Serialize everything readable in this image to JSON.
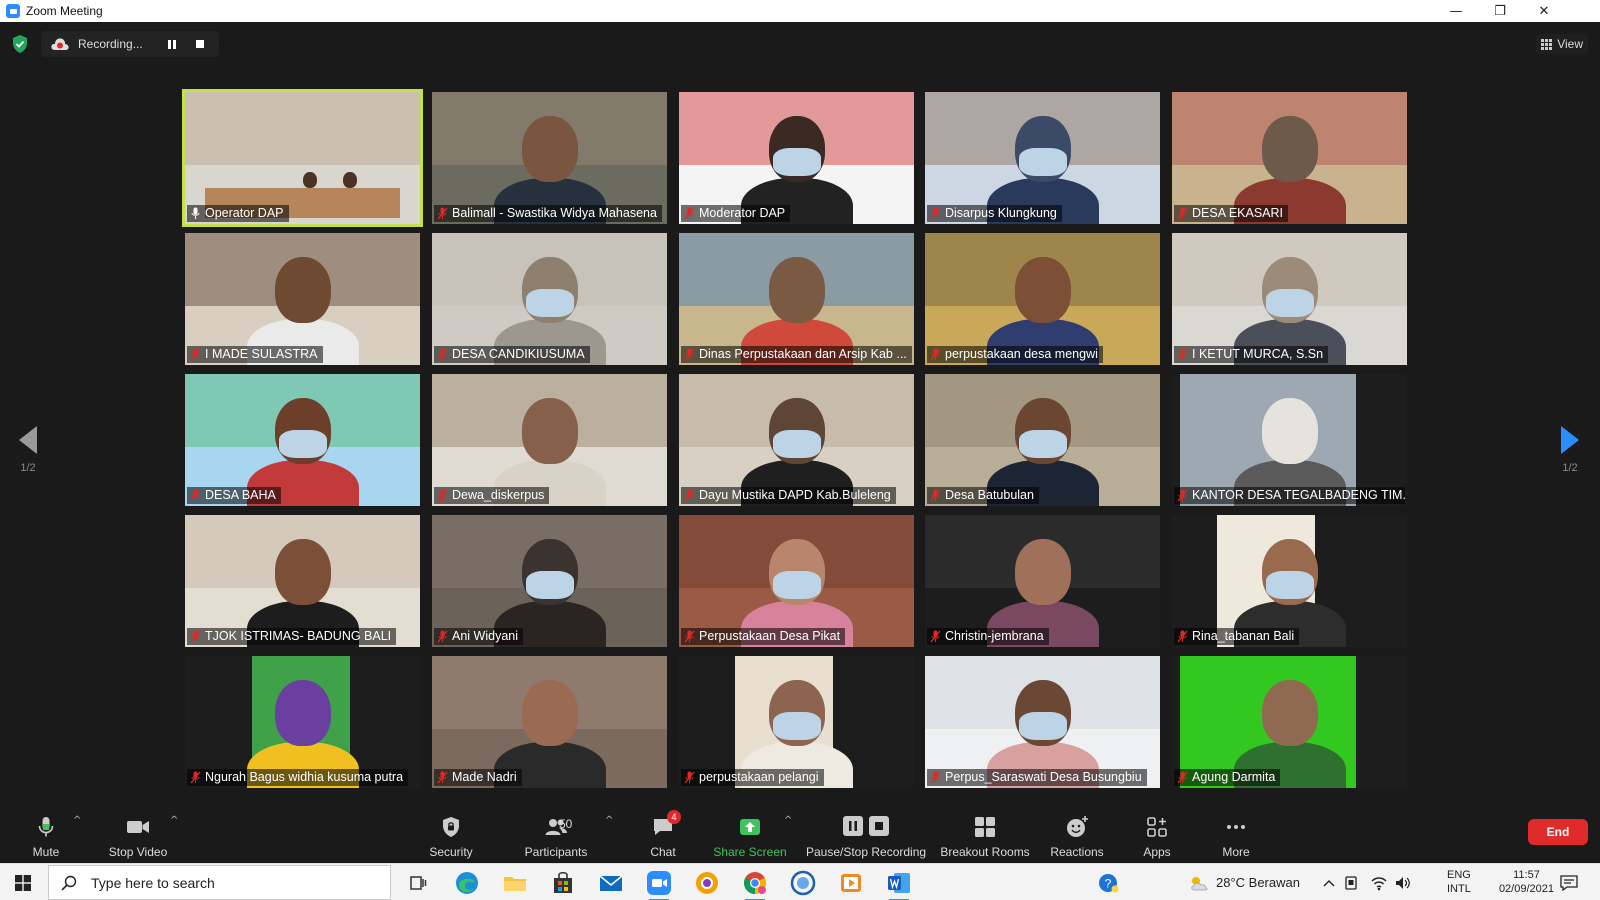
{
  "window": {
    "title": "Zoom Meeting",
    "minimize": "—",
    "restore": "❐",
    "close": "✕"
  },
  "topbar": {
    "recording_label": "Recording...",
    "view_label": "View"
  },
  "pagination": {
    "left": "1/2",
    "right": "1/2"
  },
  "participants": [
    "Operator DAP",
    "Balimall - Swastika Widya Mahasena",
    "Moderator DAP",
    "Disarpus Klungkung",
    "DESA EKASARI",
    "I MADE SULASTRA",
    "DESA CANDIKIUSUMA",
    "Dinas Perpustakaan dan Arsip Kab ...",
    "perpustakaan desa mengwi",
    "I KETUT MURCA, S.Sn",
    "DESA BAHA",
    "Dewa_diskerpus",
    "Dayu Mustika DAPD Kab.Buleleng",
    "Desa Batubulan",
    "KANTOR DESA TEGALBADENG TIM...",
    "TJOK ISTRIMAS- BADUNG BALI",
    "Ani Widyani",
    "Perpustakaan Desa Pikat",
    "Christin-jembrana",
    "Rina_tabanan Bali",
    "Ngurah Bagus widhia kusuma putra",
    "Made Nadri",
    "perpustakaan pelangi",
    "Perpus_Saraswati Desa Busungbiu",
    "Agung Darmita"
  ],
  "toolbar": {
    "mute": "Mute",
    "stop_video": "Stop Video",
    "security": "Security",
    "participants": "Participants",
    "participants_count": "50",
    "chat": "Chat",
    "chat_badge": "4",
    "share_screen": "Share Screen",
    "pause_recording": "Pause/Stop Recording",
    "breakout_rooms": "Breakout Rooms",
    "reactions": "Reactions",
    "apps": "Apps",
    "more": "More",
    "end": "End"
  },
  "taskbar": {
    "search_placeholder": "Type here to search",
    "weather": "28°C  Berawan",
    "lang_1": "ENG",
    "lang_2": "INTL",
    "time": "11:57",
    "date": "02/09/2021"
  },
  "colors": {
    "active_speaker": "#c6e04a",
    "end_button": "#e02b2b",
    "share_green": "#3fc35c",
    "accent": "#2d8cff"
  }
}
